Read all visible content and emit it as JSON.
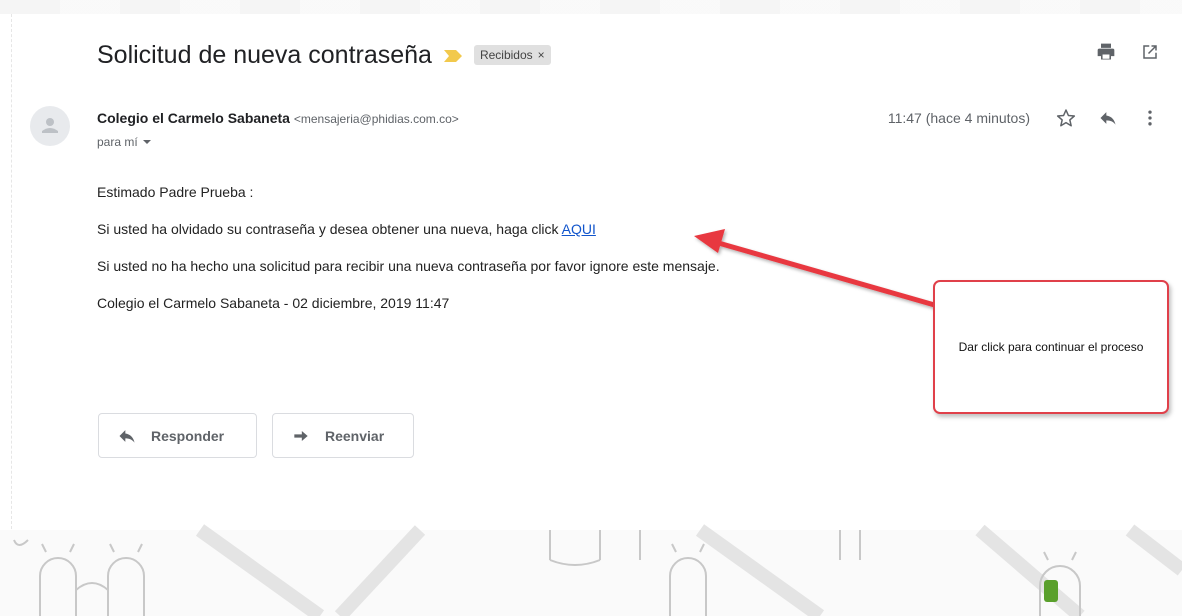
{
  "email": {
    "subject": "Solicitud de nueva contraseña",
    "label_chip": "Recibidos",
    "label_chip_close": "×",
    "sender_name": "Colegio el Carmelo Sabaneta",
    "sender_email": "<mensajeria@phidias.com.co>",
    "recipient": "para mí",
    "timestamp": "11:47 (hace 4 minutos)",
    "body": {
      "greeting": "Estimado Padre Prueba :",
      "line1_prefix": "Si usted ha olvidado su contraseña y desea obtener una nueva, haga click ",
      "line1_link": "AQUI",
      "line2": "Si usted no ha hecho una solicitud para recibir una nueva contraseña por favor ignore este mensaje.",
      "signature": "Colegio el Carmelo Sabaneta - 02 diciembre, 2019 11:47"
    }
  },
  "actions": {
    "reply_label": "Responder",
    "forward_label": "Reenviar"
  },
  "annotation": {
    "callout_text": "Dar click para continuar el proceso"
  },
  "icons": {
    "importance": "importance-marker-icon",
    "print": "print-icon",
    "open_new_window": "open-in-new-window-icon",
    "star": "star-icon",
    "reply": "reply-icon",
    "more": "more-vert-icon",
    "dropdown": "chevron-down-icon",
    "avatar": "person-icon",
    "forward": "forward-icon"
  },
  "colors": {
    "link": "#1155cc",
    "importance": "#f2c94c",
    "callout_border": "#e0404a",
    "arrow": "#e8383f"
  }
}
